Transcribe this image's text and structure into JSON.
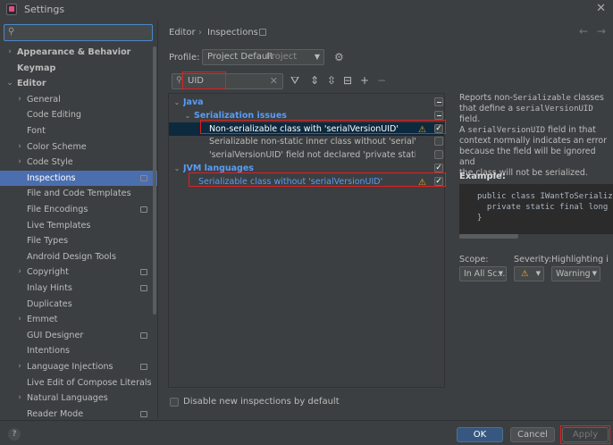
{
  "window": {
    "title": "Settings"
  },
  "sidebar": {
    "search_placeholder": "",
    "items": [
      {
        "label": "Appearance & Behavior",
        "expand": "closed",
        "indent": 0,
        "bold": true
      },
      {
        "label": "Keymap",
        "expand": "none",
        "indent": 0,
        "bold": true
      },
      {
        "label": "Editor",
        "expand": "open",
        "indent": 0,
        "bold": true
      },
      {
        "label": "General",
        "expand": "closed",
        "indent": 1
      },
      {
        "label": "Code Editing",
        "expand": "none",
        "indent": 1
      },
      {
        "label": "Font",
        "expand": "none",
        "indent": 1
      },
      {
        "label": "Color Scheme",
        "expand": "closed",
        "indent": 1
      },
      {
        "label": "Code Style",
        "expand": "closed",
        "indent": 1
      },
      {
        "label": "Inspections",
        "expand": "none",
        "indent": 1,
        "selected": true,
        "badge": true
      },
      {
        "label": "File and Code Templates",
        "expand": "none",
        "indent": 1
      },
      {
        "label": "File Encodings",
        "expand": "none",
        "indent": 1,
        "badge": true
      },
      {
        "label": "Live Templates",
        "expand": "none",
        "indent": 1
      },
      {
        "label": "File Types",
        "expand": "none",
        "indent": 1
      },
      {
        "label": "Android Design Tools",
        "expand": "none",
        "indent": 1
      },
      {
        "label": "Copyright",
        "expand": "closed",
        "indent": 1,
        "badge": true
      },
      {
        "label": "Inlay Hints",
        "expand": "none",
        "indent": 1,
        "badge": true
      },
      {
        "label": "Duplicates",
        "expand": "none",
        "indent": 1
      },
      {
        "label": "Emmet",
        "expand": "closed",
        "indent": 1
      },
      {
        "label": "GUI Designer",
        "expand": "none",
        "indent": 1,
        "badge": true
      },
      {
        "label": "Intentions",
        "expand": "none",
        "indent": 1
      },
      {
        "label": "Language Injections",
        "expand": "closed",
        "indent": 1,
        "badge": true
      },
      {
        "label": "Live Edit of Compose Literals",
        "expand": "none",
        "indent": 1
      },
      {
        "label": "Natural Languages",
        "expand": "closed",
        "indent": 1
      },
      {
        "label": "Reader Mode",
        "expand": "none",
        "indent": 1,
        "badge": true
      }
    ]
  },
  "breadcrumb": {
    "first": "Editor",
    "sep": "›",
    "second": "Inspections"
  },
  "profile": {
    "label": "Profile:",
    "value": "Project Default",
    "scope_hint": "Project"
  },
  "inspection_search": {
    "value": "UID"
  },
  "inspections": [
    {
      "label": "Java",
      "type": "group",
      "level": 0,
      "expand": "open",
      "check": "partial"
    },
    {
      "label": "Serialization issues",
      "type": "group",
      "level": 1,
      "expand": "open",
      "check": "partial"
    },
    {
      "label": "Non-serializable class with 'serialVersionUID'",
      "type": "item",
      "level": 2,
      "selected": true,
      "warn": true,
      "check": "checked"
    },
    {
      "label": "Serializable non-static inner class without 'serialVersionUID'",
      "type": "item",
      "level": 2,
      "check": "unchecked"
    },
    {
      "label": "'serialVersionUID' field not declared 'private static final long'",
      "type": "item",
      "level": 2,
      "check": "unchecked"
    },
    {
      "label": "JVM languages",
      "type": "group",
      "level": 0,
      "expand": "open",
      "check": "checked"
    },
    {
      "label": "Serializable class without 'serialVersionUID'",
      "type": "item",
      "level": 1,
      "highlight": true,
      "warn": true,
      "check": "checked"
    }
  ],
  "description": {
    "line1a": "Reports non-",
    "line1b": "Serializable",
    "line1c": " classes",
    "line2a": "that define a ",
    "line2b": "serialVersionUID",
    "line2c": " field.",
    "line3a": "A ",
    "line3b": "serialVersionUID",
    "line3c": " field in that",
    "line4": "context normally indicates an error",
    "line5": "because the field will be ignored and",
    "line6": "the class will not be serialized."
  },
  "example": {
    "heading": "Example:",
    "code_line1": "public class IWantToSerializ",
    "code_line2": "  private static final long s",
    "code_line3": "}"
  },
  "scope": {
    "label": "Scope:",
    "value": "In All Sc..."
  },
  "severity": {
    "label": "Severity:",
    "value": "⚠"
  },
  "highlighting": {
    "label": "Highlighting i",
    "value": "Warning"
  },
  "disable_new": {
    "label": "Disable new inspections by default",
    "checked": false
  },
  "buttons": {
    "ok": "OK",
    "cancel": "Cancel",
    "apply": "Apply",
    "help": "?"
  },
  "colors": {
    "accent": "#4b6eaf",
    "link": "#589df6",
    "warning": "#f0a732",
    "annotation_box": "#e02020"
  }
}
